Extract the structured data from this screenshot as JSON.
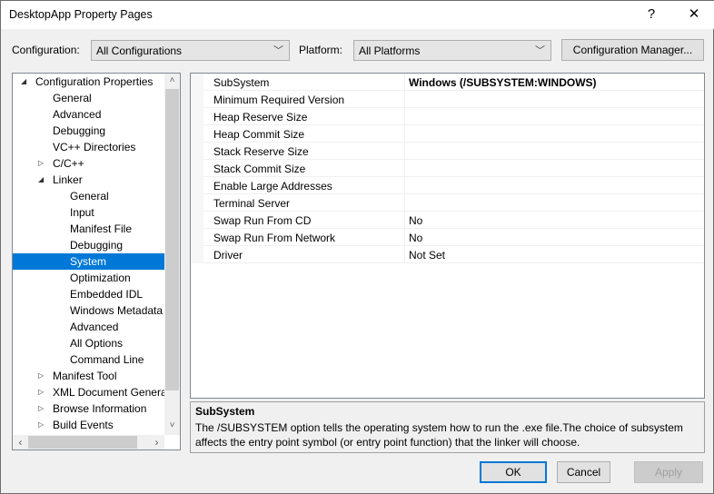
{
  "window": {
    "title": "DesktopApp Property Pages",
    "help": "?",
    "close": "✕"
  },
  "toolbar": {
    "configuration_label": "Configuration:",
    "configuration_value": "All Configurations",
    "platform_label": "Platform:",
    "platform_value": "All Platforms",
    "config_manager": "Configuration Manager..."
  },
  "tree": [
    {
      "label": "Configuration Properties",
      "level": 0,
      "state": "expanded"
    },
    {
      "label": "General",
      "level": 1
    },
    {
      "label": "Advanced",
      "level": 1
    },
    {
      "label": "Debugging",
      "level": 1
    },
    {
      "label": "VC++ Directories",
      "level": 1
    },
    {
      "label": "C/C++",
      "level": 1,
      "state": "collapsed"
    },
    {
      "label": "Linker",
      "level": 1,
      "state": "expanded"
    },
    {
      "label": "General",
      "level": 2
    },
    {
      "label": "Input",
      "level": 2
    },
    {
      "label": "Manifest File",
      "level": 2
    },
    {
      "label": "Debugging",
      "level": 2
    },
    {
      "label": "System",
      "level": 2,
      "selected": true
    },
    {
      "label": "Optimization",
      "level": 2
    },
    {
      "label": "Embedded IDL",
      "level": 2
    },
    {
      "label": "Windows Metadata",
      "level": 2
    },
    {
      "label": "Advanced",
      "level": 2
    },
    {
      "label": "All Options",
      "level": 2
    },
    {
      "label": "Command Line",
      "level": 2
    },
    {
      "label": "Manifest Tool",
      "level": 1,
      "state": "collapsed"
    },
    {
      "label": "XML Document Genera",
      "level": 1,
      "state": "collapsed"
    },
    {
      "label": "Browse Information",
      "level": 1,
      "state": "collapsed"
    },
    {
      "label": "Build Events",
      "level": 1,
      "state": "collapsed"
    }
  ],
  "properties": [
    {
      "name": "SubSystem",
      "value": "Windows (/SUBSYSTEM:WINDOWS)",
      "bold": true
    },
    {
      "name": "Minimum Required Version",
      "value": ""
    },
    {
      "name": "Heap Reserve Size",
      "value": ""
    },
    {
      "name": "Heap Commit Size",
      "value": ""
    },
    {
      "name": "Stack Reserve Size",
      "value": ""
    },
    {
      "name": "Stack Commit Size",
      "value": ""
    },
    {
      "name": "Enable Large Addresses",
      "value": ""
    },
    {
      "name": "Terminal Server",
      "value": ""
    },
    {
      "name": "Swap Run From CD",
      "value": "No"
    },
    {
      "name": "Swap Run From Network",
      "value": "No"
    },
    {
      "name": "Driver",
      "value": "Not Set"
    }
  ],
  "description": {
    "title": "SubSystem",
    "text": "The /SUBSYSTEM option tells the operating system how to run the .exe file.The choice of subsystem affects the entry point symbol (or entry point function) that the linker will choose."
  },
  "buttons": {
    "ok": "OK",
    "cancel": "Cancel",
    "apply": "Apply"
  },
  "colors": {
    "selection": "#0078d7",
    "ok_border": "#0078d7"
  }
}
